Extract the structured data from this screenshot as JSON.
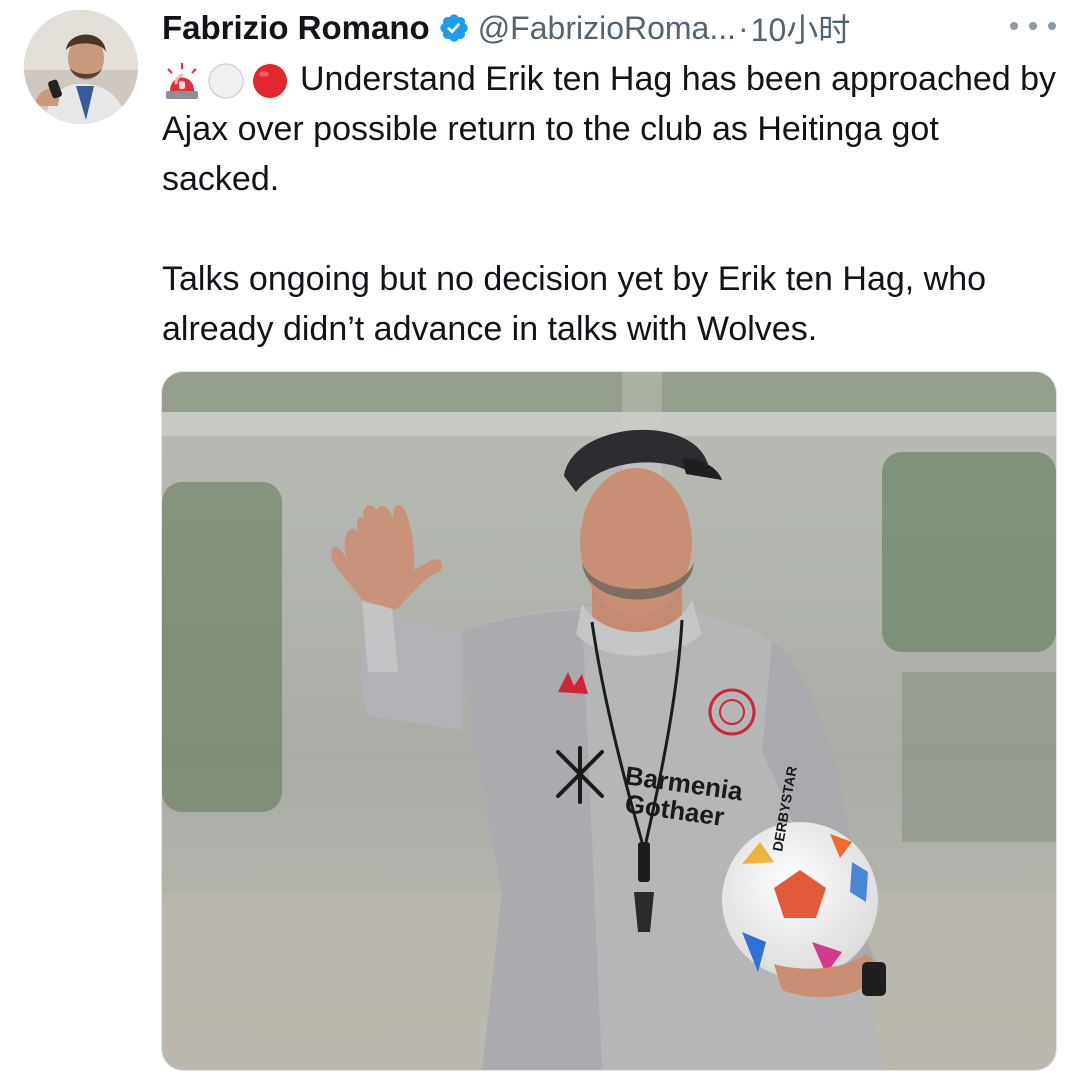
{
  "author": {
    "display_name": "Fabrizio Romano",
    "handle": "@FabrizioRoma...",
    "separator": "·",
    "time": "10小时",
    "avatar_icon": "profile-photo",
    "verified_icon": "verified-badge-icon",
    "verified_color": "#1d9bf0"
  },
  "tweet": {
    "emoji_icons": [
      "siren-emoji",
      "white-circle-emoji",
      "red-circle-emoji"
    ],
    "paragraph1": "Understand Erik ten Hag has been approached by Ajax over possible return to the club as Heitinga got sacked.",
    "paragraph2": "Talks ongoing but no decision yet by Erik ten Hag, who already didn’t advance in talks with Wolves."
  },
  "media": {
    "kit_sponsor_line1": "Barmenia",
    "kit_sponsor_line2": "Gothaer",
    "ball_brand": "DERBYSTAR"
  },
  "colors": {
    "text": "#0f1419",
    "secondary_text": "#536471",
    "siren_red": "#e0303a",
    "circle_red": "#e0282e"
  }
}
